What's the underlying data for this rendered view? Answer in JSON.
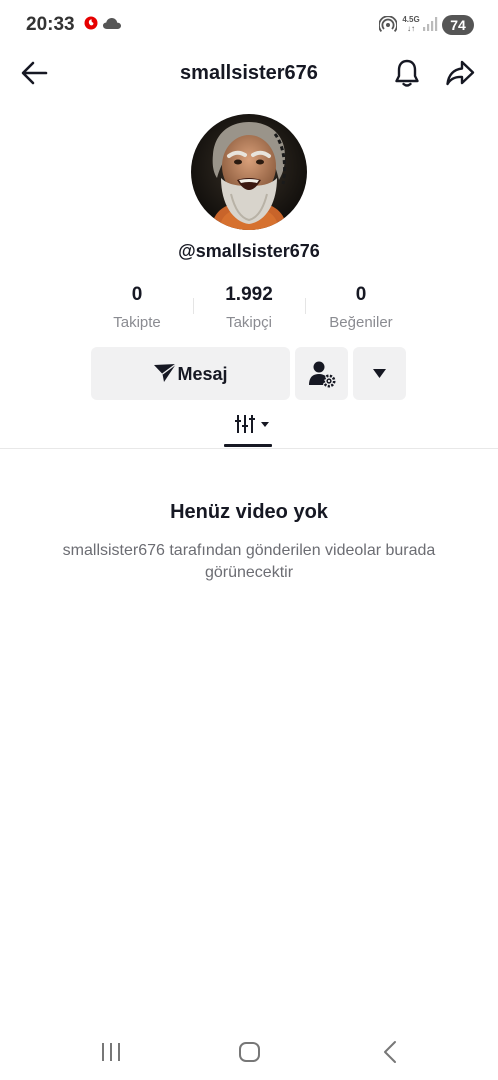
{
  "status_bar": {
    "time": "20:33",
    "network_type": "4.5G",
    "battery": "74"
  },
  "header": {
    "title": "smallsister676"
  },
  "profile": {
    "handle": "@smallsister676",
    "stats": [
      {
        "value": "0",
        "label": "Takipte"
      },
      {
        "value": "1.992",
        "label": "Takipçi"
      },
      {
        "value": "0",
        "label": "Beğeniler"
      }
    ]
  },
  "actions": {
    "message_label": "Mesaj"
  },
  "empty_state": {
    "title": "Henüz video yok",
    "description": "smallsister676 tarafından gönderilen videolar burada görünecektir"
  },
  "icons": {
    "back": "arrow-left-icon",
    "bell": "bell-icon",
    "share": "share-icon",
    "send": "send-icon",
    "user_settings": "user-gear-icon",
    "dropdown": "triangle-down-icon",
    "filter": "filter-bars-icon"
  },
  "colors": {
    "text_primary": "#161823",
    "text_secondary": "#8a8b91",
    "button_bg": "#f1f1f2",
    "vodafone_red": "#e60000"
  }
}
